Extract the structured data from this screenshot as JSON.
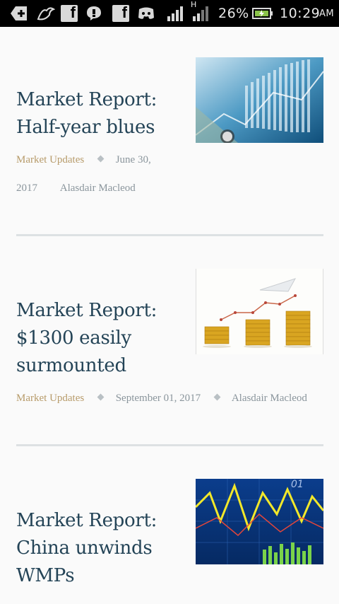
{
  "status_bar": {
    "battery": "26%",
    "time": "10:29",
    "ampm": "AM",
    "network_letter": "H",
    "icons": [
      "add-box-icon",
      "bird-icon",
      "facebook-icon",
      "messenger-icon",
      "facebook-icon",
      "discord-icon",
      "signal-icon",
      "signal-icon",
      "battery-icon"
    ]
  },
  "articles": [
    {
      "title_lines": [
        "Market Report:",
        "Half-year blues"
      ],
      "category": "Market Updates",
      "date_part1": "June 30,",
      "date_part2": "2017",
      "author": "Alasdair Macleod",
      "thumbnail": "financial-chart-dollar-image"
    },
    {
      "title_lines": [
        "Market Report:",
        "$1300 easily",
        "surmounted"
      ],
      "category": "Market Updates",
      "date": "September 01, 2017",
      "author": "Alasdair Macleod",
      "thumbnail": "gold-coins-growth-image"
    },
    {
      "title_lines": [
        "Market Report:",
        "China unwinds",
        "WMPs"
      ],
      "thumbnail": "stock-ticker-chart-image"
    }
  ]
}
